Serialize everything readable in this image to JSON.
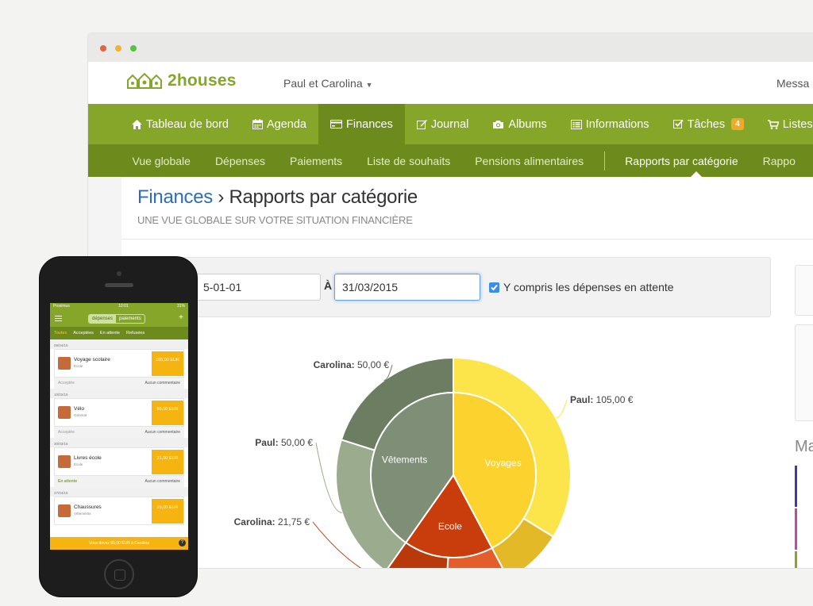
{
  "app": {
    "logo_text": "2houses",
    "family_selector": "Paul et Carolina",
    "messages_link": "Messa"
  },
  "mainnav": [
    {
      "label": "Tableau de bord",
      "icon": "home-icon"
    },
    {
      "label": "Agenda",
      "icon": "calendar-icon"
    },
    {
      "label": "Finances",
      "icon": "card-icon",
      "active": true
    },
    {
      "label": "Journal",
      "icon": "edit-icon"
    },
    {
      "label": "Albums",
      "icon": "camera-icon"
    },
    {
      "label": "Informations",
      "icon": "list-icon"
    },
    {
      "label": "Tâches",
      "icon": "checkbox-icon",
      "badge": "4"
    },
    {
      "label": "Listes",
      "icon": "cart-icon"
    }
  ],
  "subnav": [
    {
      "label": "Vue globale"
    },
    {
      "label": "Dépenses"
    },
    {
      "label": "Paiements"
    },
    {
      "label": "Liste de souhaits"
    },
    {
      "label": "Pensions alimentaires"
    },
    {
      "label": "Rapports par catégorie",
      "active": true
    },
    {
      "label": "Rappo"
    }
  ],
  "page": {
    "breadcrumb_root": "Finances",
    "separator": "›",
    "title": "Rapports par catégorie",
    "subtitle": "UNE VUE GLOBALE SUR VOTRE SITUATION FINANCIÈRE"
  },
  "filter": {
    "date_from": "5-01-01",
    "to_label": "À",
    "date_to": "31/03/2015",
    "include_pending_label": "Y compris les dépenses en attente",
    "include_pending_checked": true
  },
  "sidebar": {
    "title": "Ma"
  },
  "chart_data": {
    "type": "pie",
    "title": "",
    "inner": [
      {
        "name": "Voyages",
        "value": 105,
        "color": "#fcd22e"
      },
      {
        "name": "Ecole",
        "value": 43.5,
        "color": "#c93d0c"
      },
      {
        "name": "Vêtements",
        "value": 100,
        "color": "#7e8e77"
      }
    ],
    "outer": [
      {
        "label": "Paul: 105,00 €",
        "value": 105,
        "color": "#fbe54b"
      },
      {
        "label": "",
        "value": 0,
        "color": "#e4b928"
      },
      {
        "label": "Carolina: 21,75 €",
        "value": 21.75,
        "color": "#b83a0a"
      },
      {
        "label": "",
        "value": 21.75,
        "color": "#e35e2a"
      },
      {
        "label": "Paul: 50,00 €",
        "value": 50,
        "color": "#9aab8e"
      },
      {
        "label": "Carolina: 50,00 €",
        "value": 50,
        "color": "#6c7d62"
      }
    ]
  },
  "phone": {
    "carrier": "Proximus",
    "time": "10:01",
    "battery": "31%",
    "segments": [
      "dépenses",
      "paiements"
    ],
    "tabs": [
      {
        "label": "Toutes",
        "active": true
      },
      {
        "label": "Acceptées"
      },
      {
        "label": "En attente"
      },
      {
        "label": "Refusées"
      }
    ],
    "entries": [
      {
        "date": "09/04/15",
        "name": "Voyage scolaire",
        "category": "École",
        "amount": "165,00 EUR",
        "status": "Acceptée",
        "comment": "Aucun commentaire"
      },
      {
        "date": "10/02/15",
        "name": "Vélo",
        "category": "Général",
        "amount": "95,00 EUR",
        "status": "Acceptée",
        "comment": "Aucun commentaire"
      },
      {
        "date": "30/03/15",
        "name": "Livres école",
        "category": "École",
        "amount": "21,00 EUR",
        "status": "En attente",
        "comment": "Aucun commentaire"
      },
      {
        "date": "27/04/15",
        "name": "Chaussures",
        "category": "Vêtements",
        "amount": "25,00 EUR"
      }
    ],
    "bottom_text": "Vous devez 95,00 EUR à Carolina",
    "help": "?"
  }
}
